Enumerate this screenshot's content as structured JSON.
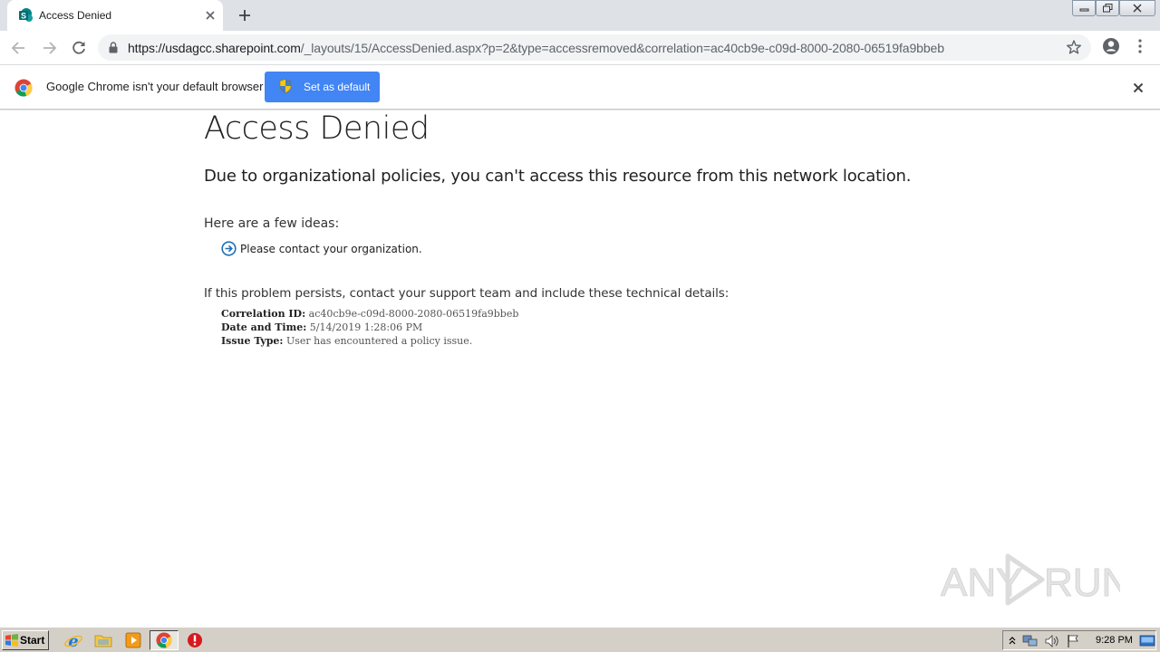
{
  "browser": {
    "tab": {
      "title": "Access Denied",
      "favicon": "sharepoint-icon"
    },
    "url": {
      "host": "https://usdagcc.sharepoint.com",
      "path": "/_layouts/15/AccessDenied.aspx?p=2&type=accessremoved&correlation=ac40cb9e-c09d-8000-2080-06519fa9bbeb"
    },
    "infobar": {
      "message": "Google Chrome isn't your default browser",
      "button_label": "Set as default"
    }
  },
  "page": {
    "title": "Access Denied",
    "subtitle": "Due to organizational policies, you can't access this resource from this network location.",
    "ideas_heading": "Here are a few ideas:",
    "ideas": [
      "Please contact your organization."
    ],
    "persists_text": "If this problem persists, contact your support team and include these technical details:",
    "details": {
      "correlation_label": "Correlation ID:",
      "correlation_value": "ac40cb9e-c09d-8000-2080-06519fa9bbeb",
      "datetime_label": "Date and Time:",
      "datetime_value": "5/14/2019 1:28:06 PM",
      "issue_label": "Issue Type:",
      "issue_value": "User has encountered a policy issue."
    }
  },
  "watermark": {
    "text_left": "ANY",
    "text_right": "RUN"
  },
  "taskbar": {
    "start_label": "Start",
    "clock": "9:28 PM"
  },
  "colors": {
    "accent": "#4285f4",
    "idea_arrow": "#1b6fb5",
    "tabstrip": "#dee1e6",
    "taskbar": "#d4d0c8"
  }
}
